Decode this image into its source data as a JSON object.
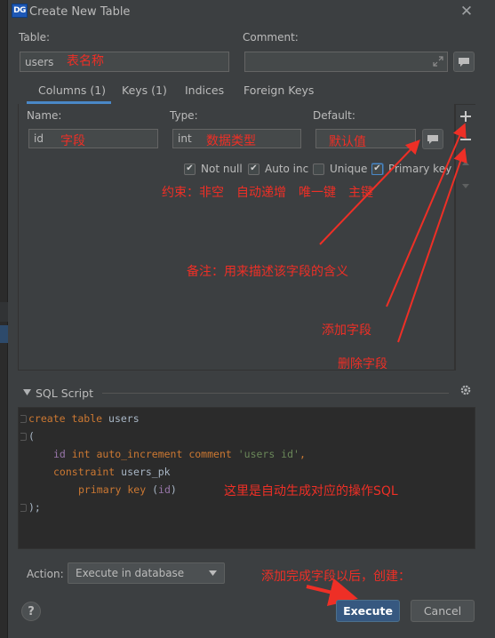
{
  "window": {
    "logo_text": "DG",
    "title": "Create New Table"
  },
  "table": {
    "label": "Table:",
    "value": "users",
    "annotation": "表名称"
  },
  "comment": {
    "label": "Comment:",
    "value": ""
  },
  "tabs": [
    {
      "label": "Columns (1)",
      "active": true
    },
    {
      "label": "Keys (1)",
      "active": false
    },
    {
      "label": "Indices",
      "active": false
    },
    {
      "label": "Foreign Keys",
      "active": false
    }
  ],
  "column": {
    "name_label": "Name:",
    "name_value": "id",
    "name_annotation": "字段",
    "type_label": "Type:",
    "type_value": "int",
    "type_annotation": "数据类型",
    "default_label": "Default:",
    "default_value": "",
    "default_annotation": "默认值"
  },
  "constraints": [
    {
      "label": "Not null",
      "checked": true
    },
    {
      "label": "Auto inc",
      "checked": true
    },
    {
      "label": "Unique",
      "checked": false
    },
    {
      "label": "Primary key",
      "checked": true
    }
  ],
  "annotations": {
    "constraints": "约束：非空　自动递增　唯一键　主键",
    "comment": "备注：用来描述该字段的含义",
    "add_field": "添加字段",
    "remove_field": "删除字段",
    "sql": "这里是自动生成对应的操作SQL",
    "execute": "添加完成字段以后，创建："
  },
  "sql": {
    "section_label": "SQL Script",
    "lines": [
      {
        "kw1": "create table",
        "plain": " users"
      },
      {
        "plain": "("
      },
      {
        "id": "id",
        "kw": " int auto_increment comment",
        "str": " 'users id'",
        "tail": ","
      },
      {
        "kw": "constraint",
        "plain": " users_pk"
      },
      {
        "kw": "primary key",
        "plain": " (",
        "id": "id",
        "tail": ")"
      },
      {
        "plain": ");"
      }
    ]
  },
  "footer": {
    "action_label": "Action:",
    "action_value": "Execute in database",
    "help_label": "?",
    "execute_label": "Execute",
    "cancel_label": "Cancel"
  },
  "colors": {
    "accent": "#4a88c7",
    "annotation": "#ee2f26",
    "primary_button": "#365880"
  }
}
